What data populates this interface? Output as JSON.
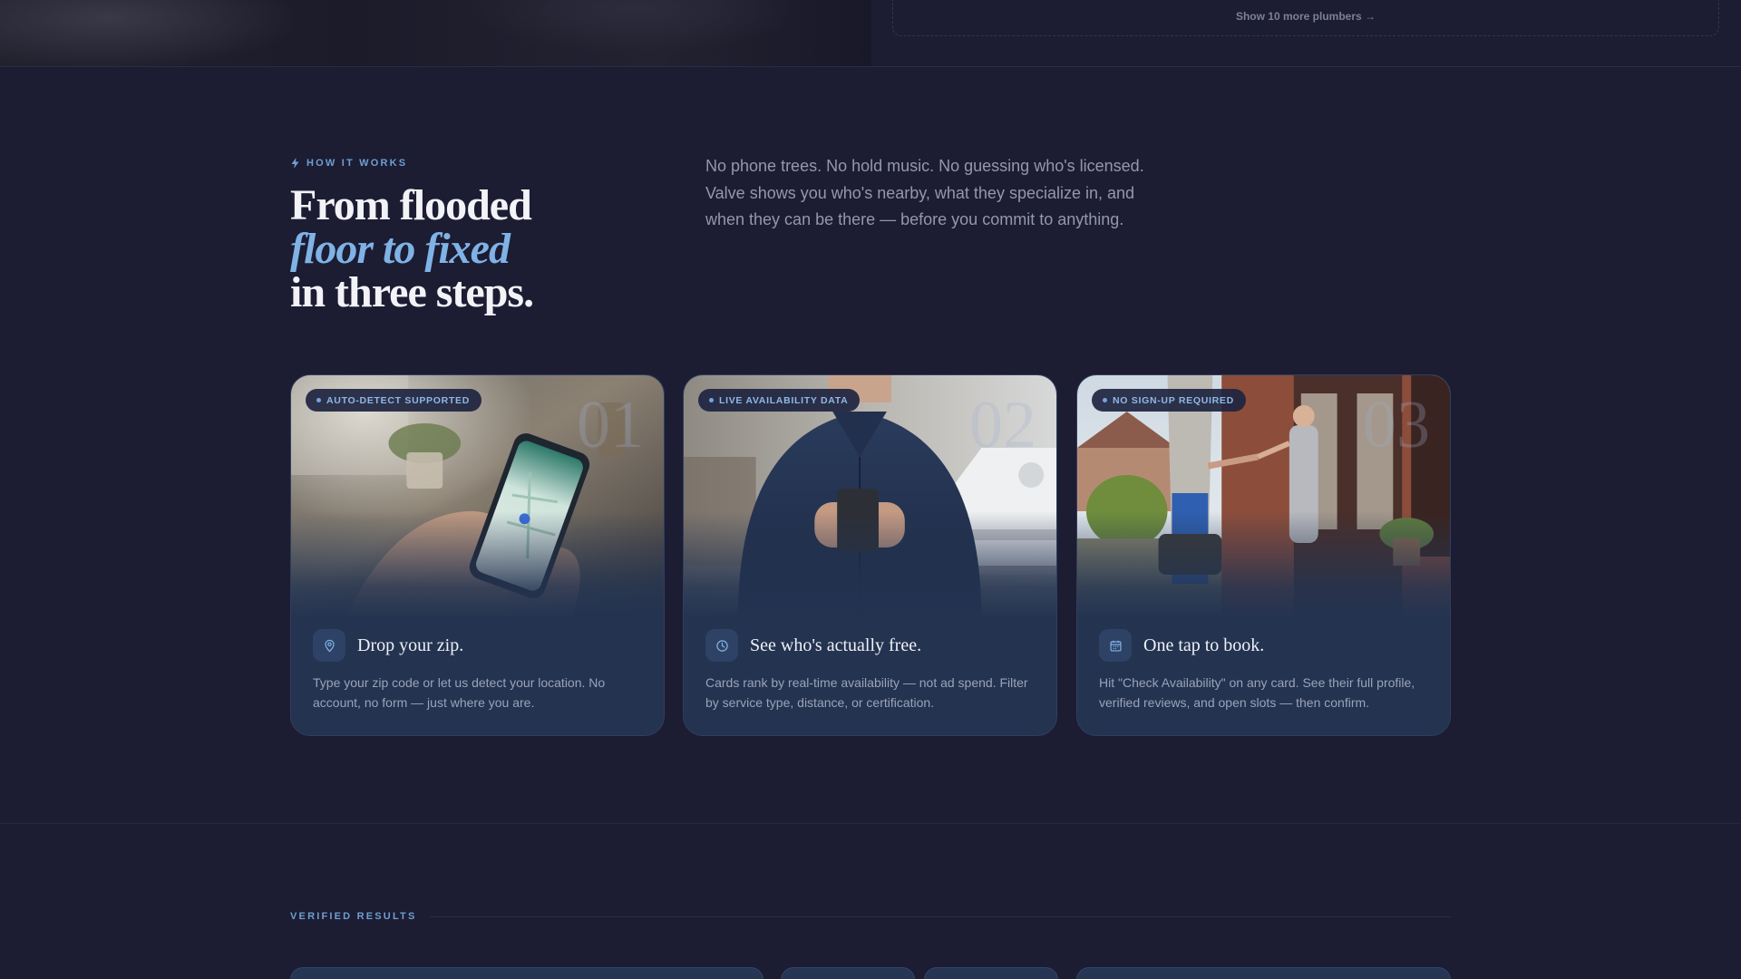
{
  "top": {
    "show_more": "Show 10 more plumbers →"
  },
  "how_it_works": {
    "eyebrow": "HOW IT WORKS",
    "headline": {
      "line1": "From flooded",
      "line2": "floor to fixed",
      "line3": "in three steps."
    },
    "intro": "No phone trees. No hold music. No guessing who's licensed. Valve shows you who's nearby, what they specialize in, and when they can be there — before you commit to anything."
  },
  "steps": [
    {
      "number": "01",
      "badge": "AUTO-DETECT SUPPORTED",
      "icon": "map-pin-icon",
      "title": "Drop your zip.",
      "description": "Type your zip code or let us detect your location. No account, no form — just where you are."
    },
    {
      "number": "02",
      "badge": "LIVE AVAILABILITY DATA",
      "icon": "clock-icon",
      "title": "See who's actually free.",
      "description": "Cards rank by real-time availability — not ad spend. Filter by service type, distance, or certification."
    },
    {
      "number": "03",
      "badge": "NO SIGN-UP REQUIRED",
      "icon": "calendar-icon",
      "title": "One tap to book.",
      "description": "Hit \"Check Availability\" on any card. See their full profile, verified reviews, and open slots — then confirm."
    }
  ],
  "verified": {
    "label": "VERIFIED RESULTS"
  },
  "colors": {
    "background": "#1c1c33",
    "card": "#233350",
    "accent": "#7fb2e5",
    "eyebrow": "#6f9fd0"
  }
}
